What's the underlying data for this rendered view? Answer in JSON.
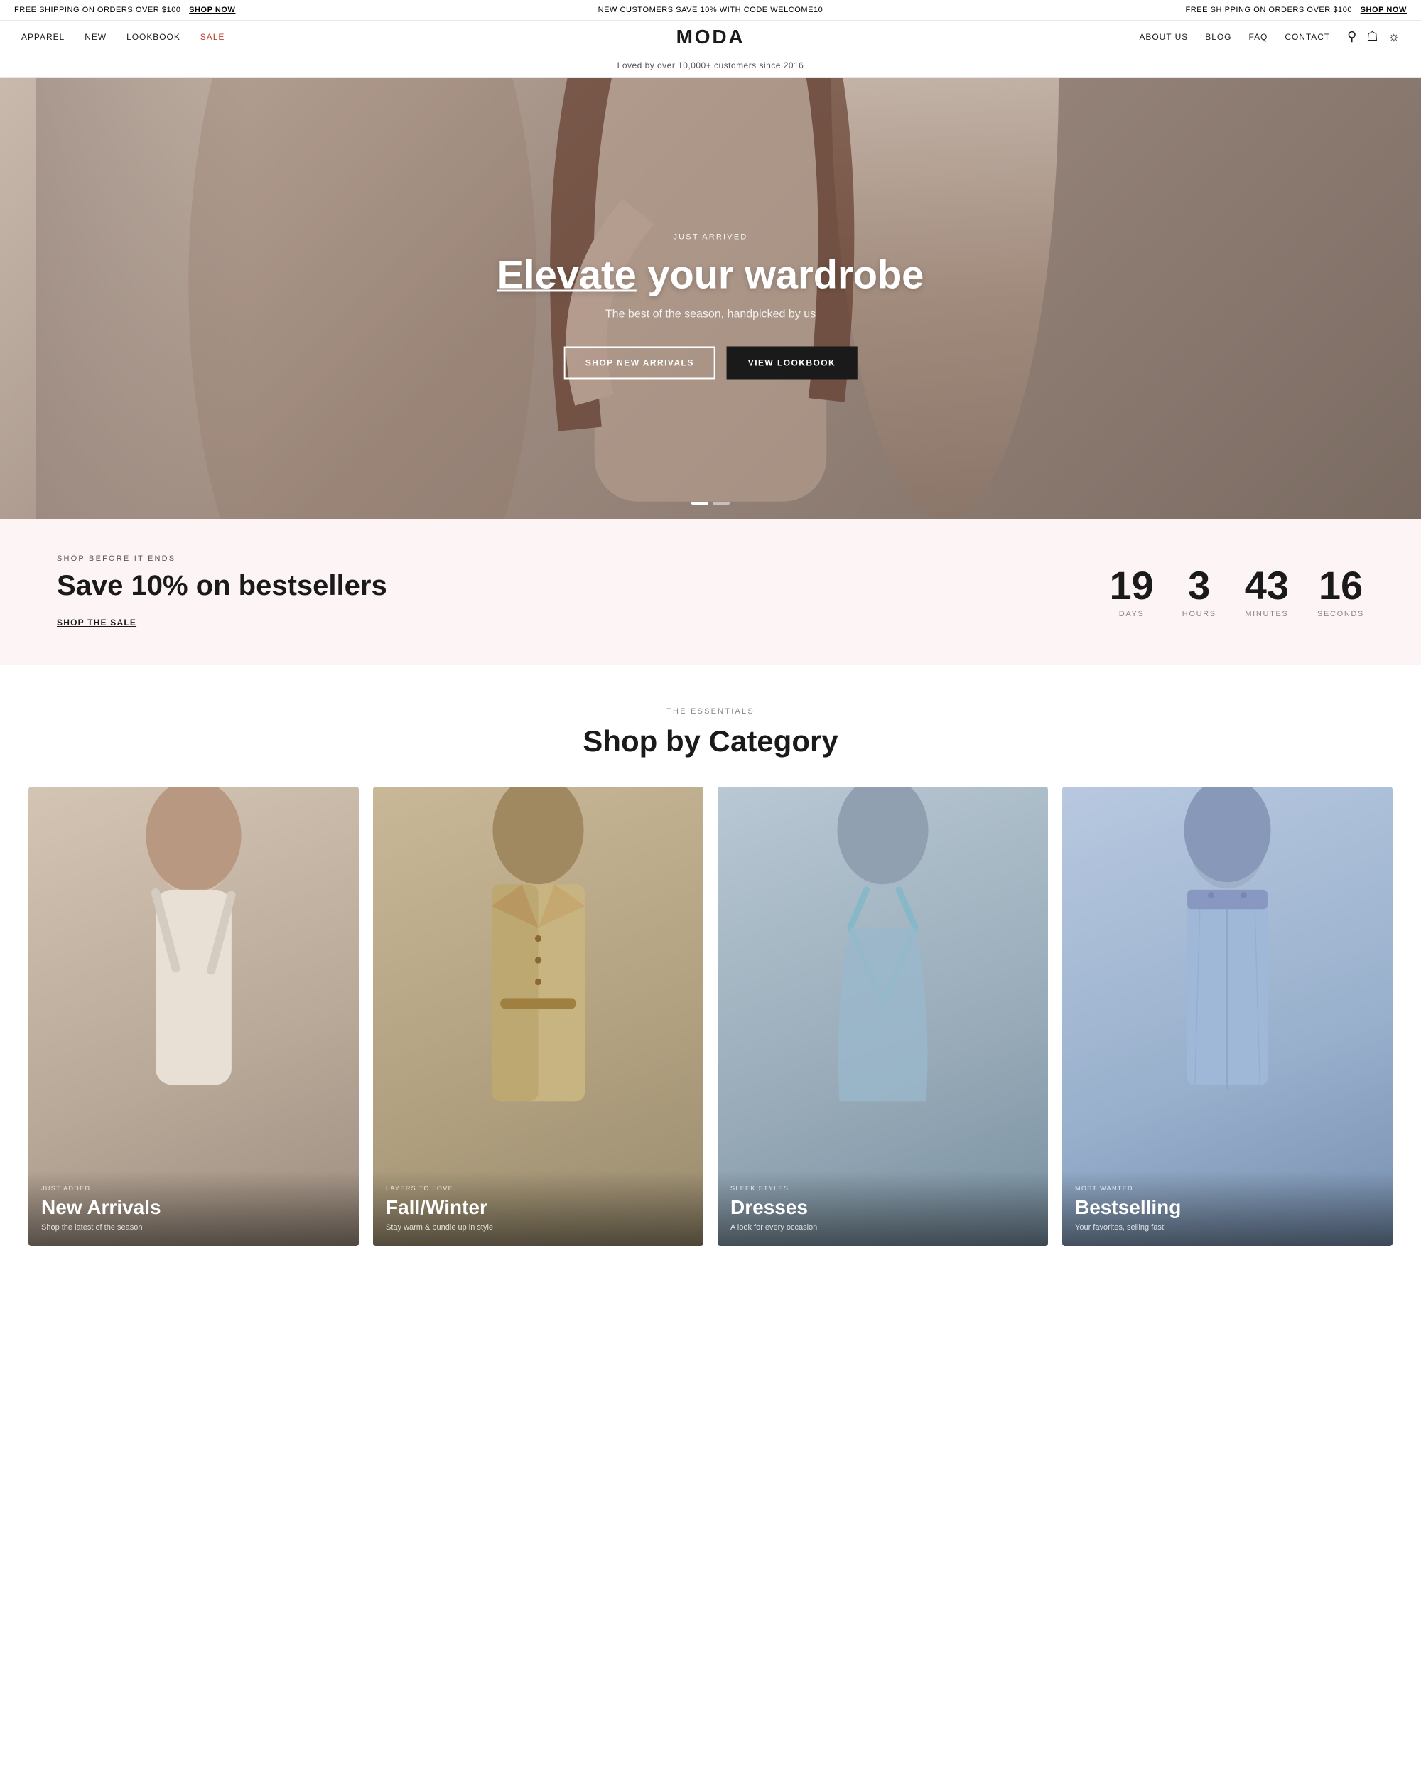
{
  "announcement": {
    "left_text": "FREE SHIPPING ON ORDERS OVER $100",
    "left_link": "SHOP NOW",
    "center_text": "NEW CUSTOMERS SAVE 10% WITH CODE WELCOME10",
    "right_text": "FREE SHIPPING ON ORDERS OVER $100",
    "right_link": "SHOP NOW"
  },
  "nav": {
    "links_left": [
      {
        "label": "APPAREL",
        "sale": false
      },
      {
        "label": "NEW",
        "sale": false
      },
      {
        "label": "LOOKBOOK",
        "sale": false
      },
      {
        "label": "SALE",
        "sale": true
      }
    ],
    "logo": "MODA",
    "links_right": [
      {
        "label": "ABOUT US"
      },
      {
        "label": "BLOG"
      },
      {
        "label": "FAQ"
      },
      {
        "label": "CONTACT"
      }
    ]
  },
  "trust_bar": {
    "text": "Loved by over 10,000+ customers since 2016"
  },
  "hero": {
    "eyebrow": "JUST ARRIVED",
    "title_part1": "Elevate your wardrobe",
    "subtitle": "The best of the season, handpicked by us",
    "btn_primary": "SHOP NEW ARRIVALS",
    "btn_secondary": "VIEW LOOKBOOK"
  },
  "sale_banner": {
    "eyebrow": "SHOP BEFORE IT ENDS",
    "title": "Save 10% on bestsellers",
    "link": "SHOP THE SALE",
    "countdown": {
      "days": "19",
      "hours": "3",
      "minutes": "43",
      "seconds": "16",
      "days_label": "DAYS",
      "hours_label": "HOURS",
      "minutes_label": "MINUTES",
      "seconds_label": "SECONDS"
    }
  },
  "categories": {
    "eyebrow": "THE ESSENTIALS",
    "title": "Shop by Category",
    "items": [
      {
        "eyebrow": "JUST ADDED",
        "name": "New Arrivals",
        "desc": "Shop the latest of the season",
        "theme": "new"
      },
      {
        "eyebrow": "LAYERS TO LOVE",
        "name": "Fall/Winter",
        "desc": "Stay warm & bundle up in style",
        "theme": "fall"
      },
      {
        "eyebrow": "SLEEK STYLES",
        "name": "Dresses",
        "desc": "A look for every occasion",
        "theme": "dresses"
      },
      {
        "eyebrow": "MOST WANTED",
        "name": "Bestselling",
        "desc": "Your favorites, selling fast!",
        "theme": "bestselling"
      }
    ]
  }
}
